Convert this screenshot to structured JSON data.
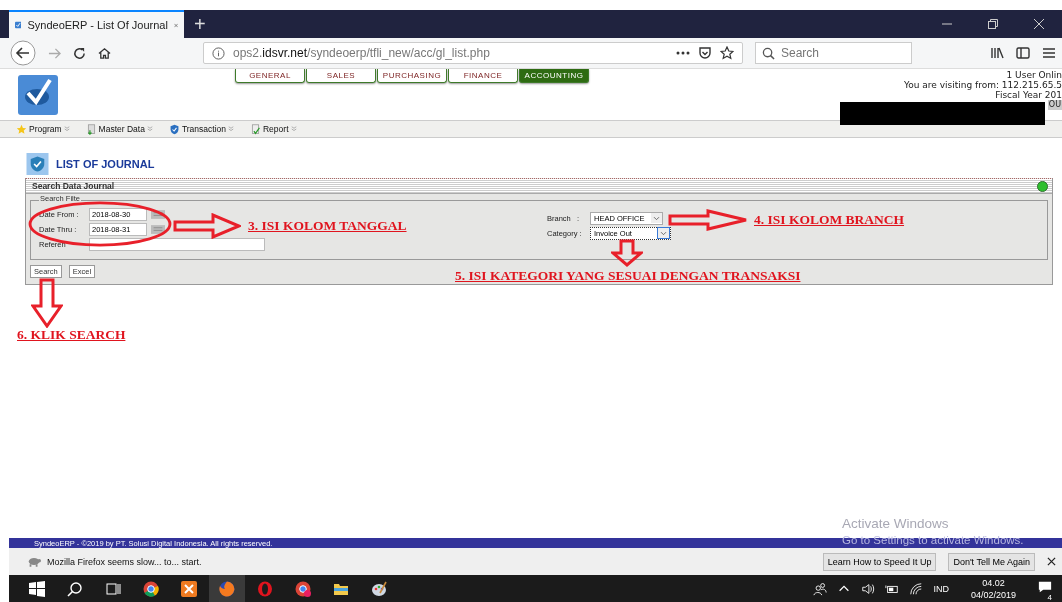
{
  "browser": {
    "tab_title": "SyndeoERP - List Of Journal",
    "new_tab": "+",
    "url": "ops2.**idsvr.net**/syndeoerp/tfli_new/acc/gl_list.php",
    "search_placeholder": "Search"
  },
  "modules": [
    {
      "label": "GENERAL",
      "selected": false
    },
    {
      "label": "SALES",
      "selected": false
    },
    {
      "label": "PURCHASING",
      "selected": false
    },
    {
      "label": "FINANCE",
      "selected": false
    },
    {
      "label": "ACCOUNTING",
      "selected": true
    }
  ],
  "user_info": [
    "1 User Onlin",
    "You are visiting from: 112.215.65.5",
    "Fiscal Year 201"
  ],
  "logout_label": "OU",
  "menu": [
    {
      "label": "Program"
    },
    {
      "label": "Master Data"
    },
    {
      "label": "Transaction"
    },
    {
      "label": "Report"
    }
  ],
  "page_title": "LIST OF JOURNAL",
  "panel": {
    "title": "Search Data Journal",
    "legend": "Search Filte",
    "left_fields": [
      {
        "label": "Date From :",
        "value": "2018-08-30",
        "kind": "date"
      },
      {
        "label": "Date Thru :",
        "value": "2018-08-31",
        "kind": "date"
      },
      {
        "label": "Referen",
        "kind": "text"
      }
    ],
    "right_fields": [
      {
        "label": "Branch   :",
        "value": "HEAD OFFICE",
        "focused": false
      },
      {
        "label": "Category :",
        "value": "Invoice Out",
        "focused": true
      }
    ],
    "buttons": [
      "Search",
      "Excel"
    ]
  },
  "annotations": [
    "3. ISI KOLOM TANGGAL",
    "4. ISI KOLOM BRANCH",
    "5. ISI KATEGORI YANG SESUAI DENGAN TRANSAKSI",
    "6. KLIK SEARCH"
  ],
  "footer": "SyndeoERP - ©2019 by PT. Solusi Digital Indonesia. All rights reserved.",
  "activate_windows": [
    "Activate Windows",
    "Go to Settings to activate Windows."
  ],
  "notification": {
    "message": "Mozilla Firefox seems slow... to... start.",
    "buttons": [
      "Learn How to Speed It Up",
      "Don't Tell Me Again"
    ]
  },
  "taskbar": {
    "language": "IND",
    "time": "04.02",
    "date": "04/02/2019",
    "notifications": "4"
  }
}
